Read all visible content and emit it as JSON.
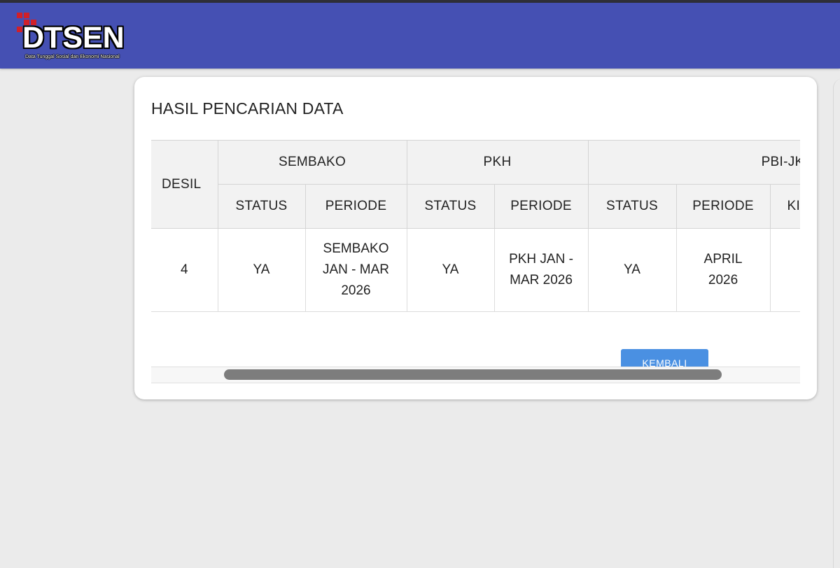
{
  "header": {
    "logo_text": "DTSEN",
    "logo_subtitle": "Data Tunggal Sosial dan Ekonomi Nasional",
    "brand_color": "#4550b3"
  },
  "card": {
    "title": "HASIL PENCARIAN DATA"
  },
  "table": {
    "desil_header": "DESIL",
    "groups": [
      "SEMBAKO",
      "PKH",
      "PBI-JK"
    ],
    "subheaders": [
      "STATUS",
      "PERIODE",
      "STATUS",
      "PERIODE",
      "STATUS",
      "PERIODE",
      "KI"
    ],
    "rows": [
      [
        "4",
        "YA",
        "SEMBAKO JAN - MAR 2026",
        "YA",
        "PKH JAN - MAR 2026",
        "YA",
        "APRIL 2026",
        ""
      ]
    ]
  },
  "button": {
    "label": "KEMBALI",
    "color": "#4a90e2"
  }
}
